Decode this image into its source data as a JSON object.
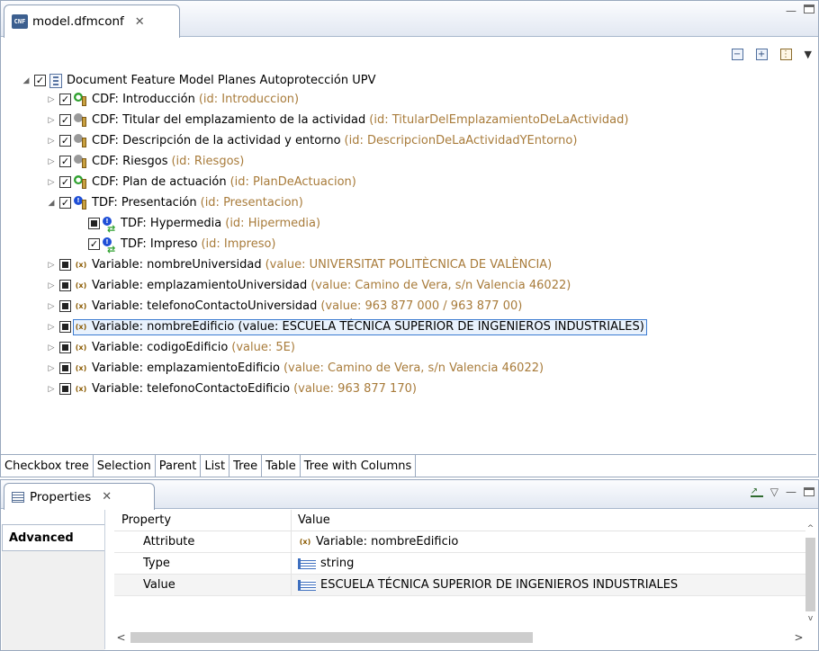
{
  "editor": {
    "tab_title": "model.dfmconf",
    "tab_close": "✕",
    "root": {
      "label": "Document Feature Model Planes Autoprotección UPV"
    },
    "rows": [
      {
        "label": "CDF: Introducción",
        "meta": "(id: Introduccion)"
      },
      {
        "label": "CDF: Titular del emplazamiento de la actividad",
        "meta": "(id: TitularDelEmplazamientoDeLaActividad)"
      },
      {
        "label": "CDF: Descripción de la actividad y entorno",
        "meta": "(id: DescripcionDeLaActividadYEntorno)"
      },
      {
        "label": "CDF: Riesgos",
        "meta": "(id: Riesgos)"
      },
      {
        "label": "CDF: Plan de actuación",
        "meta": "(id: PlanDeActuacion)"
      },
      {
        "label": "TDF: Presentación",
        "meta": "(id: Presentacion)"
      },
      {
        "label": "TDF: Hypermedia",
        "meta": "(id: Hipermedia)"
      },
      {
        "label": "TDF: Impreso",
        "meta": "(id: Impreso)"
      },
      {
        "label": "Variable: nombreUniversidad",
        "meta": "(value: UNIVERSITAT POLITÈCNICA DE VALÈNCIA)"
      },
      {
        "label": "Variable: emplazamientoUniversidad",
        "meta": "(value: Camino de Vera, s/n Valencia 46022)"
      },
      {
        "label": "Variable: telefonoContactoUniversidad",
        "meta": "(value: 963 877 000 / 963 877 00)"
      },
      {
        "label": "Variable: nombreEdificio (value: ESCUELA TÉCNICA SUPERIOR DE INGENIEROS INDUSTRIALES)",
        "meta": ""
      },
      {
        "label": "Variable: codigoEdificio",
        "meta": "(value: 5E)"
      },
      {
        "label": "Variable: emplazamientoEdificio",
        "meta": "(value: Camino de Vera, s/n Valencia 46022)"
      },
      {
        "label": "Variable: telefonoContactoEdificio",
        "meta": "(value: 963 877 170)"
      }
    ],
    "bottom_tabs": [
      "Checkbox tree",
      "Selection",
      "Parent",
      "List",
      "Tree",
      "Table",
      "Tree with Columns"
    ],
    "colors": {
      "meta_text": "#a87b3a",
      "selection_border": "#3b7bd1"
    }
  },
  "properties": {
    "title": "Properties",
    "close": "✕",
    "side_tab": "Advanced",
    "headers": {
      "property": "Property",
      "value": "Value"
    },
    "rows": [
      {
        "property": "Attribute",
        "value": "Variable: nombreEdificio"
      },
      {
        "property": "Type",
        "value": "string"
      },
      {
        "property": "Value",
        "value": "ESCUELA TÉCNICA SUPERIOR DE INGENIEROS INDUSTRIALES"
      }
    ],
    "scroll": {
      "left": "<",
      "right": ">",
      "up": "^",
      "down": "v"
    }
  }
}
